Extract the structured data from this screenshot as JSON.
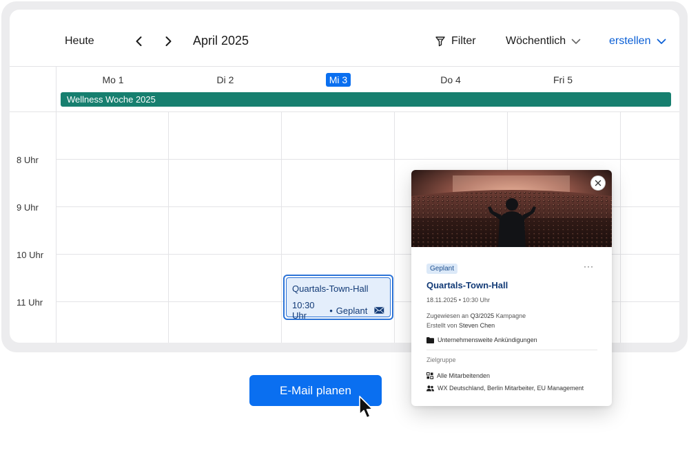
{
  "toolbar": {
    "today_label": "Heute",
    "month_label": "April 2025",
    "filter_label": "Filter",
    "view_label": "Wöchentlich",
    "create_label": "erstellen"
  },
  "days": [
    "Mo 1",
    "Di 2",
    "Mi 3",
    "Do 4",
    "Fri 5"
  ],
  "today_index": 2,
  "allday_event": "Wellness Woche 2025",
  "hours": [
    "8 Uhr",
    "9 Uhr",
    "10 Uhr",
    "11 Uhr"
  ],
  "event": {
    "title": "Quartals-Town-Hall",
    "time": "10:30 Uhr",
    "separator": "•",
    "status": "Geplant"
  },
  "popover": {
    "badge": "Geplant",
    "more": "···",
    "title": "Quartals-Town-Hall",
    "meta": "18.11.2025 • 10:30 Uhr",
    "assigned_prefix": "Zugewiesen an",
    "assigned_campaign": "Q3/2025",
    "assigned_suffix": "Kampagne",
    "created_prefix": "Erstellt von",
    "created_by": "Steven Chen",
    "folder": "Unternehmensweite Ankündigungen",
    "section_title": "Zielgruppe",
    "audience_all": "Alle Mitarbeitenden",
    "audience_groups": "WX Deutschland, Berlin Mitarbeiter, EU Management"
  },
  "cta_label": "E-Mail planen",
  "colors": {
    "accent": "#0a6ff0",
    "allday": "#177f6f",
    "event_bg": "#e4eefb",
    "event_text": "#123a76"
  }
}
